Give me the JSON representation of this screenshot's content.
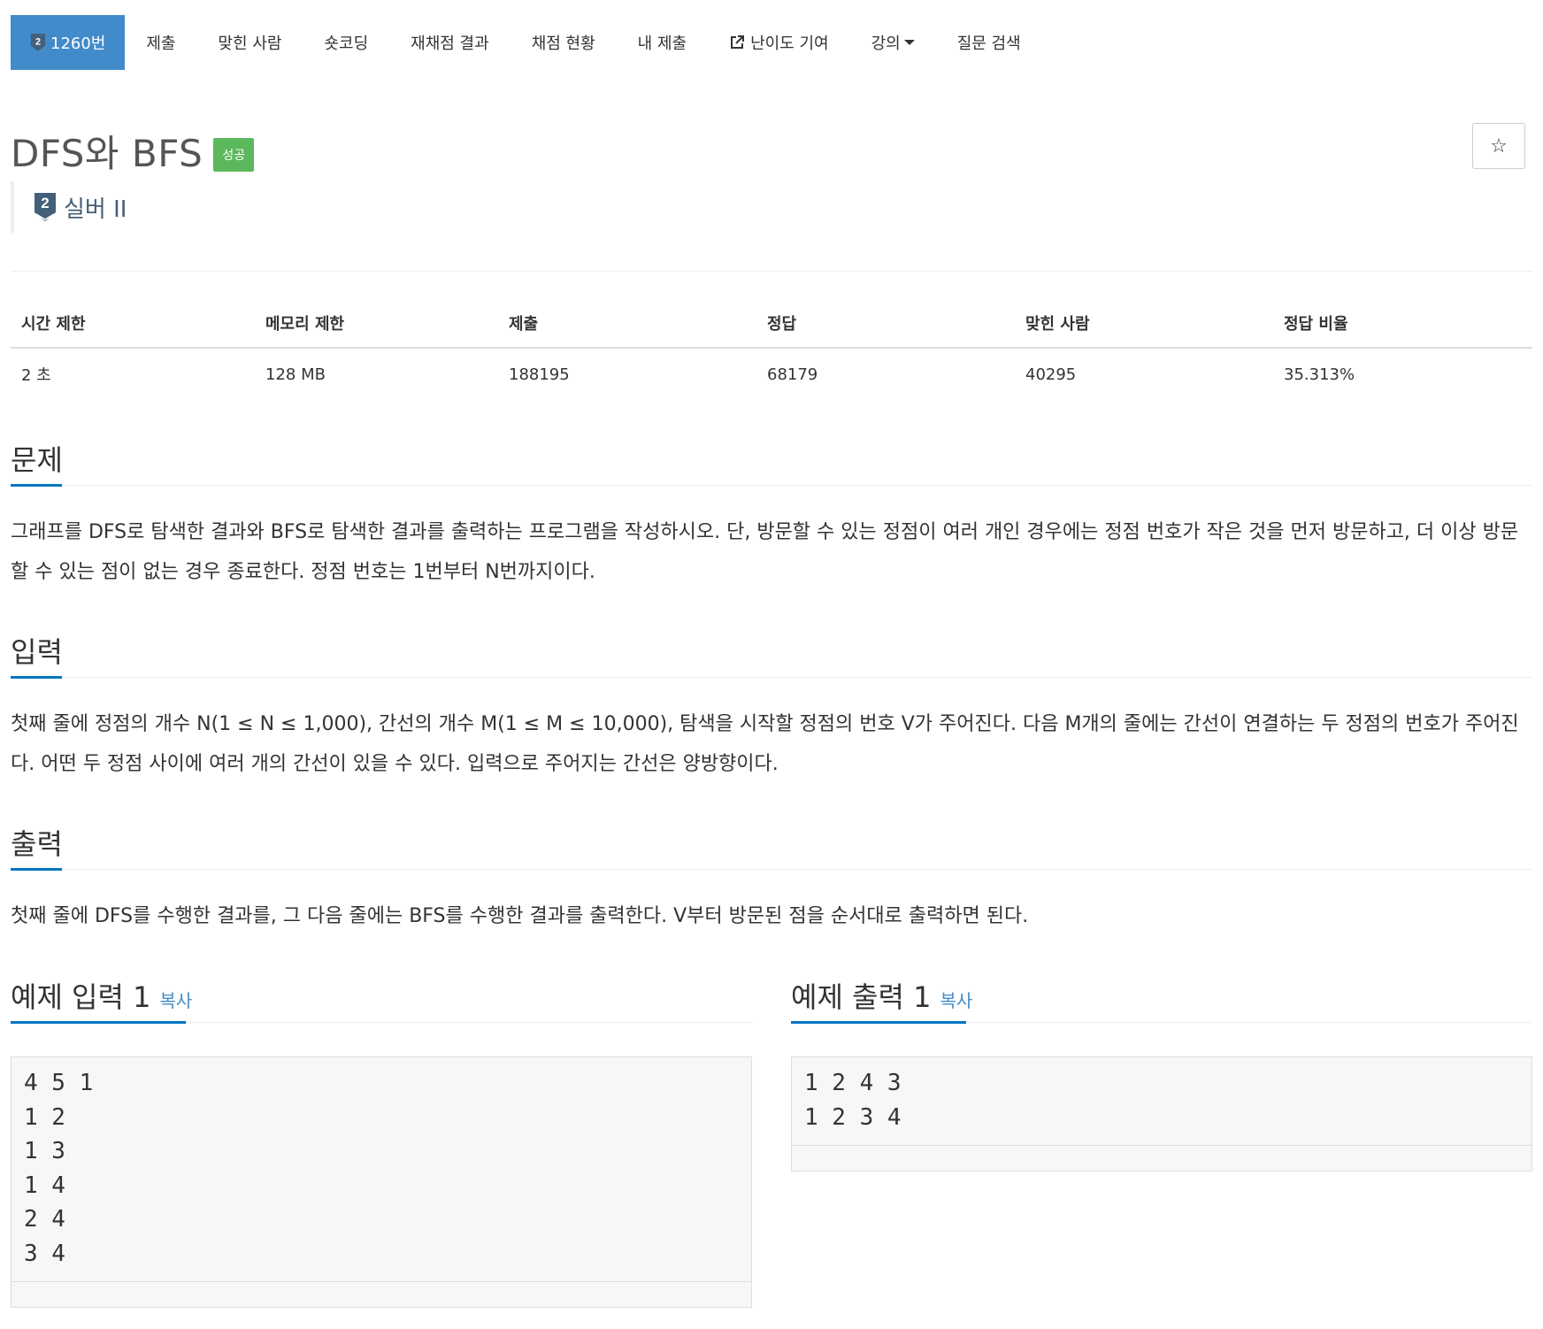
{
  "nav": {
    "problem_tab": "1260번",
    "tabs": [
      "제출",
      "맞힌 사람",
      "숏코딩",
      "재채점 결과",
      "채점 현황",
      "내 제출"
    ],
    "difficulty_tab": "난이도 기여",
    "lecture_tab": "강의",
    "question_tab": "질문 검색"
  },
  "problem": {
    "title": "DFS와 BFS",
    "status_badge": "성공",
    "tier_label": "실버 II",
    "tier_number": "2",
    "star": "☆"
  },
  "info": {
    "headers": [
      "시간 제한",
      "메모리 제한",
      "제출",
      "정답",
      "맞힌 사람",
      "정답 비율"
    ],
    "values": [
      "2 초",
      "128 MB",
      "188195",
      "68179",
      "40295",
      "35.313%"
    ]
  },
  "sections": {
    "problem_head": "문제",
    "problem_text": "그래프를 DFS로 탐색한 결과와 BFS로 탐색한 결과를 출력하는 프로그램을 작성하시오. 단, 방문할 수 있는 정점이 여러 개인 경우에는 정점 번호가 작은 것을 먼저 방문하고, 더 이상 방문할 수 있는 점이 없는 경우 종료한다. 정점 번호는 1번부터 N번까지이다.",
    "input_head": "입력",
    "input_text": "첫째 줄에 정점의 개수 N(1 ≤ N ≤ 1,000), 간선의 개수 M(1 ≤ M ≤ 10,000), 탐색을 시작할 정점의 번호 V가 주어진다. 다음 M개의 줄에는 간선이 연결하는 두 정점의 번호가 주어진다. 어떤 두 정점 사이에 여러 개의 간선이 있을 수 있다. 입력으로 주어지는 간선은 양방향이다.",
    "output_head": "출력",
    "output_text": "첫째 줄에 DFS를 수행한 결과를, 그 다음 줄에는 BFS를 수행한 결과를 출력한다. V부터 방문된 점을 순서대로 출력하면 된다."
  },
  "samples": {
    "input_head": "예제 입력 1",
    "output_head": "예제 출력 1",
    "copy": "복사",
    "input_text": "4 5 1\n1 2\n1 3\n1 4\n2 4\n3 4",
    "output_text": "1 2 4 3\n1 2 3 4"
  }
}
